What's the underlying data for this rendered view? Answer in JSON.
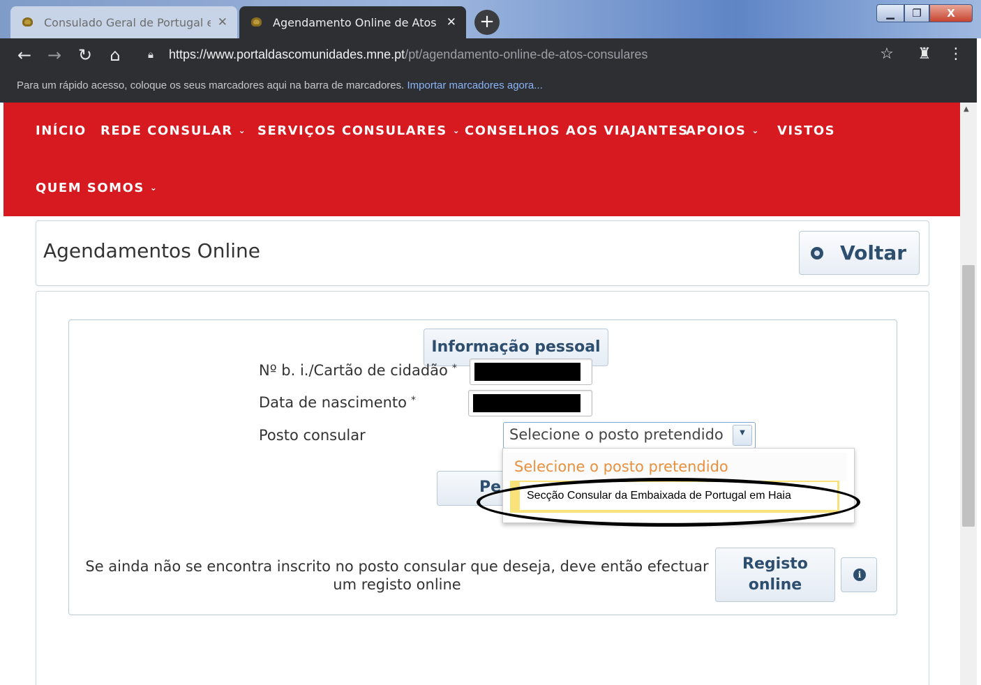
{
  "browser": {
    "tabs": [
      {
        "title": "Consulado Geral de Portugal em",
        "active": false
      },
      {
        "title": "Agendamento Online de Atos Co",
        "active": true
      }
    ],
    "new_tab_icon": "+",
    "close_icon": "✕",
    "window_controls": {
      "minimize": "▁",
      "maximize": "❐",
      "close": "X"
    },
    "url_host": "https://www.portaldascomunidades.mne.pt",
    "url_path": "/pt/agendamento-online-de-atos-consulares",
    "bookmarks_text": "Para um rápido acesso, coloque os seus marcadores aqui na barra de marcadores.",
    "bookmarks_link": "Importar marcadores agora..."
  },
  "site_nav": {
    "items": [
      {
        "label": "INÍCIO",
        "dropdown": false
      },
      {
        "label": "REDE CONSULAR",
        "dropdown": true
      },
      {
        "label": "SERVIÇOS CONSULARES",
        "dropdown": true
      },
      {
        "label": "CONSELHOS AOS VIAJANTES",
        "dropdown": false
      },
      {
        "label": "APOIOS",
        "dropdown": true
      },
      {
        "label": "VISTOS",
        "dropdown": false
      },
      {
        "label": "QUEM SOMOS",
        "dropdown": true
      }
    ],
    "background_color": "#d71920"
  },
  "header": {
    "title": "Agendamentos Online",
    "back_button": "Voltar"
  },
  "form": {
    "legend": "Informação pessoal",
    "fields": {
      "id_label": "Nº b. i./Cartão de cidadão",
      "dob_label": "Data de nascimento",
      "post_label": "Posto consular",
      "required_mark": "*"
    },
    "select": {
      "value": "Selecione o posto pretendido",
      "options": [
        "Selecione o posto pretendido",
        "Secção Consular da Embaixada de Portugal em Haia"
      ]
    },
    "search_button_partial": "Pe"
  },
  "registration": {
    "text": "Se ainda não se encontra inscrito no posto consular que deseja, deve então efectuar um registo online",
    "button": "Registo online",
    "info_icon": "i"
  },
  "colors": {
    "accent": "#2d4e6e",
    "option_highlight": "#f9e27a",
    "placeholder_option": "#e8903d"
  }
}
